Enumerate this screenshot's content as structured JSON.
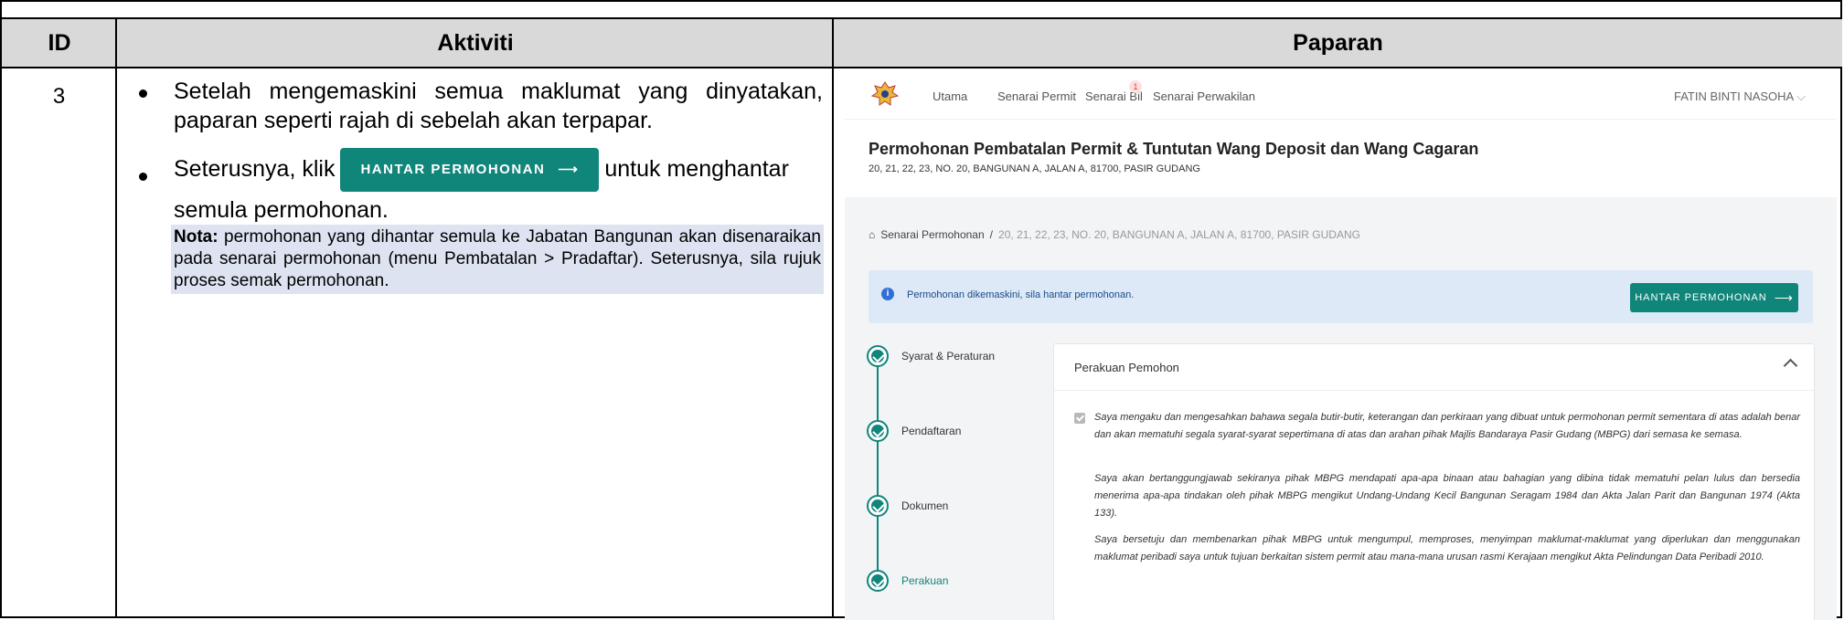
{
  "table": {
    "headers": {
      "id": "ID",
      "aktiviti": "Aktiviti",
      "paparan": "Paparan"
    },
    "row_id": "3",
    "bullets": [
      "Setelah mengemaskini semua maklumat yang dinyatakan, paparan seperti rajah di sebelah akan terpapar.",
      "Seterusnya, klik"
    ],
    "bullet2_after": "untuk menghantar",
    "bullet2_line2": "semula permohonan.",
    "inline_button_label": "HANTAR PERMOHONAN",
    "note_label": "Nota:",
    "note_text": " permohonan yang dihantar semula ke Jabatan Bangunan akan disenaraikan pada senarai permohonan (menu Pembatalan > Pradaftar). Seterusnya, sila rujuk proses semak permohonan."
  },
  "screenshot": {
    "nav": [
      "Utama",
      "Senarai Permit",
      "Senarai Bil",
      "Senarai Perwakilan"
    ],
    "badge_count": "1",
    "user": "FATIN BINTI NASOHA",
    "title": "Permohonan Pembatalan Permit & Tuntutan Wang Deposit dan Wang Cagaran",
    "subtitle": "20, 21, 22, 23, NO. 20, BANGUNAN A, JALAN A, 81700, PASIR GUDANG",
    "breadcrumb_root": "Senarai Permohonan",
    "breadcrumb_sep": "/",
    "breadcrumb_current": "20, 21, 22, 23, NO. 20, BANGUNAN A, JALAN A, 81700, PASIR GUDANG",
    "alert_text": "Permohonan dikemaskini, sila hantar permohonan.",
    "send_button": "HANTAR PERMOHONAN",
    "steps": [
      "Syarat & Peraturan",
      "Pendaftaran",
      "Dokumen",
      "Perakuan"
    ],
    "card_title": "Perakuan Pemohon",
    "paragraphs": [
      "Saya mengaku dan mengesahkan bahawa segala butir-butir, keterangan dan perkiraan yang dibuat untuk permohonan permit sementara di atas adalah benar dan akan mematuhi segala syarat-syarat sepertimana di atas dan arahan pihak Majlis Bandaraya Pasir Gudang (MBPG) dari semasa ke semasa.",
      "Saya akan bertanggungjawab sekiranya pihak MBPG mendapati apa-apa binaan atau bahagian yang dibina tidak mematuhi pelan lulus dan bersedia menerima apa-apa tindakan oleh pihak MBPG mengikut Undang-Undang Kecil Bangunan Seragam 1984 dan Akta Jalan Parit dan Bangunan 1974 (Akta 133).",
      "Saya bersetuju dan membenarkan pihak MBPG untuk mengumpul, memproses, menyimpan maklumat-maklumat yang diperlukan dan menggunakan maklumat peribadi saya untuk tujuan berkaitan sistem permit atau mana-mana urusan rasmi Kerajaan mengikut Akta Pelindungan Data Peribadi 2010."
    ]
  }
}
